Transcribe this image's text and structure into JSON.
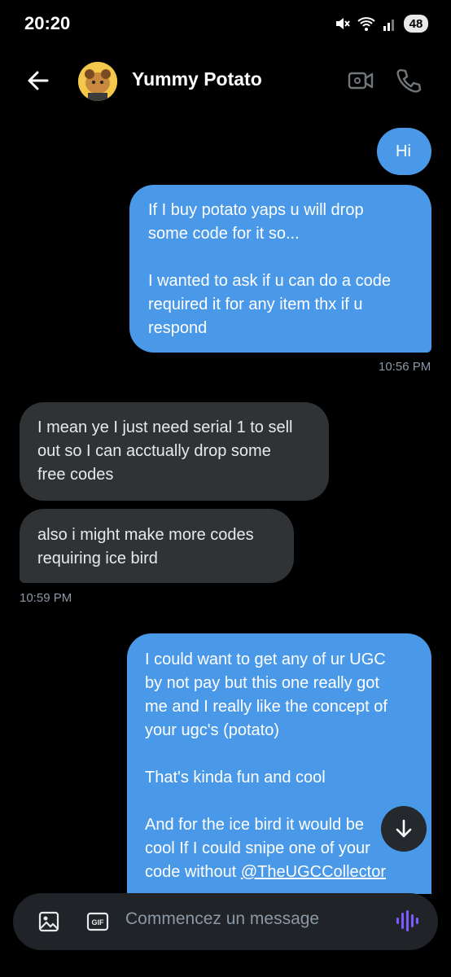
{
  "status": {
    "time": "20:20",
    "battery": "48"
  },
  "header": {
    "contact_name": "Yummy Potato"
  },
  "messages": {
    "m1": "Hi",
    "m2": "If I buy potato yaps u will drop\nsome code for it so...\n\nI wanted to ask if u can do a code\nrequired it for any item thx if u\nrespond",
    "t1": "10:56 PM",
    "m3": "I mean ye I just need serial 1 to sell\nout so I can acctually drop some\nfree codes",
    "m4": "also i might make more codes\nrequiring ice bird",
    "t2": "10:59 PM",
    "m5": "I could want to get any of ur UGC\nby not pay but this one really got\nme and I really like the concept of\nyour ugc's (potato)\n\nThat's kinda fun and cool\n\nAnd for the ice bird it would be\ncool If I could snipe one of your\ncode without ",
    "m5_mention": "@TheUGCCollector"
  },
  "composer": {
    "placeholder": "Commencez un message"
  },
  "colors": {
    "outgoing": "#4a99e9",
    "incoming": "#2f3336",
    "accent": "#7c5cff"
  }
}
